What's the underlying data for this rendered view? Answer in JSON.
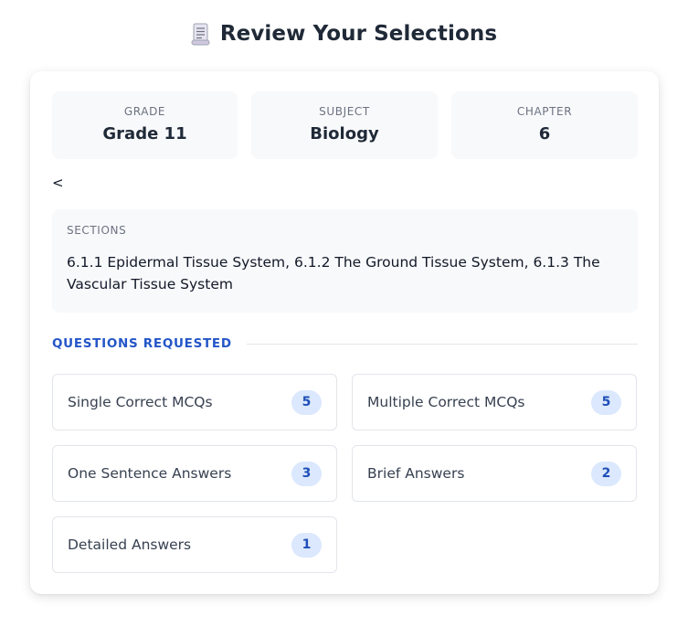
{
  "page": {
    "title": "Review Your Selections",
    "title_icon": "scroll-icon"
  },
  "info": [
    {
      "label": "GRADE",
      "value": "Grade 11"
    },
    {
      "label": "SUBJECT",
      "value": "Biology"
    },
    {
      "label": "CHAPTER",
      "value": "6"
    }
  ],
  "stray_text": "<",
  "sections": {
    "label": "SECTIONS",
    "value": "6.1.1 Epidermal Tissue System, 6.1.2 The Ground Tissue System, 6.1.3 The Vascular Tissue System"
  },
  "questions": {
    "header": "QUESTIONS REQUESTED",
    "items": [
      {
        "label": "Single Correct MCQs",
        "count": "5"
      },
      {
        "label": "Multiple Correct MCQs",
        "count": "5"
      },
      {
        "label": "One Sentence Answers",
        "count": "3"
      },
      {
        "label": "Brief Answers",
        "count": "2"
      },
      {
        "label": "Detailed Answers",
        "count": "1"
      }
    ]
  },
  "colors": {
    "accent": "#2456c8",
    "badge_bg": "#dbe8fd",
    "panel_bg": "#f8f9fb"
  }
}
